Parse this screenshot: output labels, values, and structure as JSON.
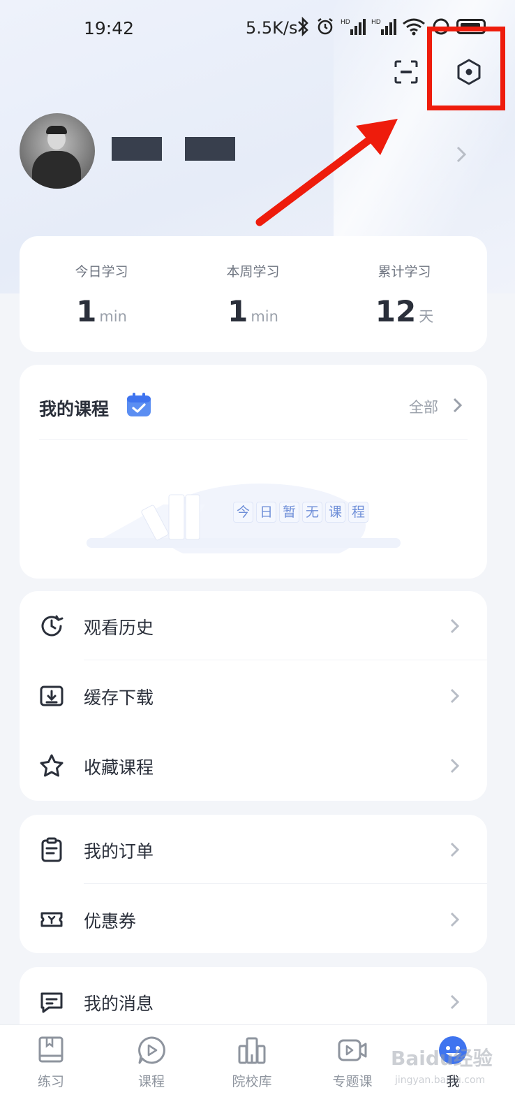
{
  "status_bar": {
    "time": "19:42",
    "network_speed": "5.5K/s",
    "icons": [
      "bluetooth-icon",
      "alarm-icon",
      "hd-signal-icon",
      "hd-signal-icon",
      "wifi-icon",
      "battery-icon"
    ]
  },
  "header": {
    "scan_icon": "scan-icon",
    "settings_icon": "settings-hexagon-icon",
    "annotation_color": "#ee1c0c"
  },
  "profile": {
    "avatar": "avatar-photo"
  },
  "stats": [
    {
      "label": "今日学习",
      "value": "1",
      "unit": "min"
    },
    {
      "label": "本周学习",
      "value": "1",
      "unit": "min"
    },
    {
      "label": "累计学习",
      "value": "12",
      "unit": "天"
    }
  ],
  "my_courses": {
    "title": "我的课程",
    "all_link": "全部",
    "empty_chars": [
      "今",
      "日",
      "暂",
      "无",
      "课",
      "程"
    ]
  },
  "menu_group_1": [
    {
      "label": "观看历史",
      "icon": "clock-history-icon"
    },
    {
      "label": "缓存下载",
      "icon": "download-icon"
    },
    {
      "label": "收藏课程",
      "icon": "star-icon"
    }
  ],
  "menu_group_2": [
    {
      "label": "我的订单",
      "icon": "clipboard-icon"
    },
    {
      "label": "优惠券",
      "icon": "ticket-icon"
    }
  ],
  "menu_group_3": [
    {
      "label": "我的消息",
      "icon": "message-icon"
    }
  ],
  "tabbar": [
    {
      "label": "练习",
      "icon": "book-icon",
      "active": false
    },
    {
      "label": "课程",
      "icon": "play-bubble-icon",
      "active": false
    },
    {
      "label": "院校库",
      "icon": "building-icon",
      "active": false
    },
    {
      "label": "专题课",
      "icon": "video-icon",
      "active": false
    },
    {
      "label": "我",
      "icon": "profile-face-icon",
      "active": true
    }
  ],
  "watermark": {
    "text": "Baidu经验",
    "url_text": "jingyan.baidu.com"
  },
  "colors": {
    "accent_blue": "#3f74ef",
    "text_dark": "#2a2f3a",
    "text_gray": "#9aa0aa"
  }
}
